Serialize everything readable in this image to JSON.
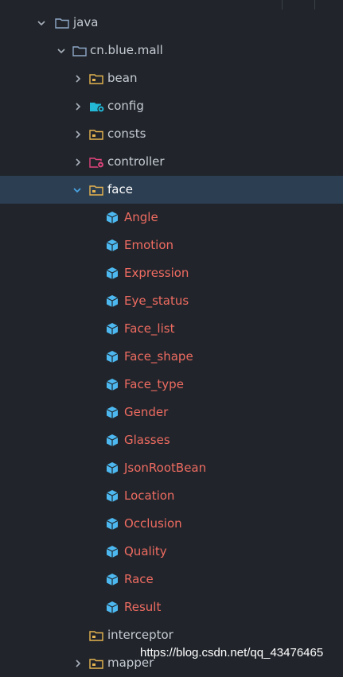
{
  "tree": {
    "java": {
      "label": "java",
      "icon": "folder-icon",
      "chevron": "expanded"
    },
    "package": {
      "label": "cn.blue.mall",
      "icon": "package-folder-icon",
      "chevron": "expanded"
    },
    "bean": {
      "label": "bean",
      "icon": "package-icon",
      "chevron": "collapsed"
    },
    "config": {
      "label": "config",
      "icon": "config-package-icon",
      "chevron": "collapsed"
    },
    "consts": {
      "label": "consts",
      "icon": "package-icon",
      "chevron": "collapsed"
    },
    "controller": {
      "label": "controller",
      "icon": "controller-package-icon",
      "chevron": "collapsed"
    },
    "face": {
      "label": "face",
      "icon": "package-icon",
      "chevron": "expanded",
      "selected": true,
      "classes": [
        "Angle",
        "Emotion",
        "Expression",
        "Eye_status",
        "Face_list",
        "Face_shape",
        "Face_type",
        "Gender",
        "Glasses",
        "JsonRootBean",
        "Location",
        "Occlusion",
        "Quality",
        "Race",
        "Result"
      ]
    },
    "interceptor": {
      "label": "interceptor",
      "icon": "package-icon"
    },
    "mapper": {
      "label": "mapper",
      "icon": "package-icon",
      "chevron": "collapsed"
    }
  },
  "colors": {
    "background": "#21252b",
    "selection": "#2c3e52",
    "class_text": "#ef6b61",
    "package_text": "#c5cad3",
    "class_icon": "#4db8f0",
    "package_folder": "#e6b450",
    "config_icon": "#22b8d6",
    "controller_icon": "#e2447c"
  },
  "watermark": "https://blog.csdn.net/qq_43476465"
}
